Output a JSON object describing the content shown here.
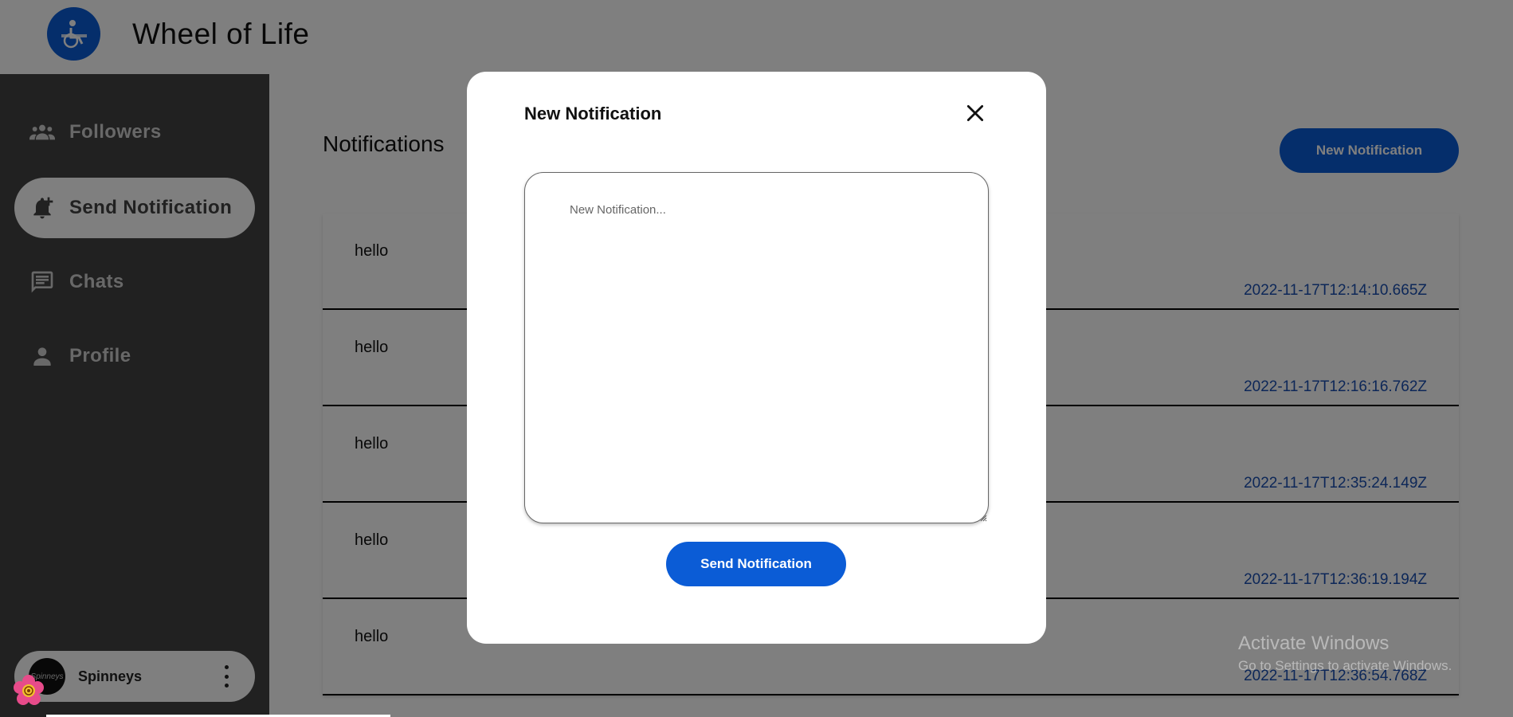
{
  "header": {
    "title": "Wheel of Life",
    "logo": "wheelchair-logo-icon"
  },
  "sidebar": {
    "items": [
      {
        "label": "Followers",
        "icon": "group-icon",
        "active": false
      },
      {
        "label": "Send Notification",
        "icon": "bell-plus-icon",
        "active": true
      },
      {
        "label": "Chats",
        "icon": "chat-icon",
        "active": false
      },
      {
        "label": "Profile",
        "icon": "person-icon",
        "active": false
      }
    ],
    "account": {
      "name": "Spinneys",
      "avatar_text": "Spinneys"
    }
  },
  "main": {
    "title": "Notifications",
    "new_button": "New Notification",
    "notifications": [
      {
        "message": "hello",
        "time": "2022-11-17T12:14:10.665Z"
      },
      {
        "message": "hello",
        "time": "2022-11-17T12:16:16.762Z"
      },
      {
        "message": "hello",
        "time": "2022-11-17T12:35:24.149Z"
      },
      {
        "message": "hello",
        "time": "2022-11-17T12:36:19.194Z"
      },
      {
        "message": "hello",
        "time": "2022-11-17T12:36:54.768Z"
      }
    ]
  },
  "modal": {
    "title": "New Notification",
    "textarea_placeholder": "New Notification...",
    "textarea_value": "",
    "send_button": "Send Notification"
  },
  "watermark": {
    "line1": "Activate Windows",
    "line2": "Go to Settings to activate Windows."
  },
  "colors": {
    "primary": "#0b5cd6",
    "sidebar": "#424242",
    "timestamp": "#1a4fb0"
  }
}
